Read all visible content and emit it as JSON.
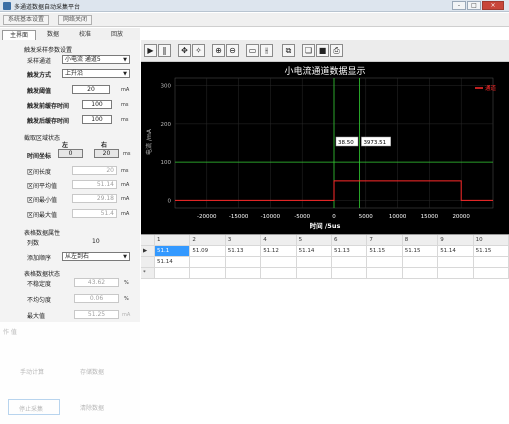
{
  "window": {
    "title": "多通道数据自动采集平台",
    "controls": [
      "-",
      "□",
      "×"
    ]
  },
  "menu": {
    "system_settings": "系统基本设置",
    "network_close": "网络关闭"
  },
  "tabs": [
    "主界面",
    "数据",
    "校准",
    "回放"
  ],
  "params": {
    "group_title": "触发采样参数设置",
    "channel_label": "采样通道",
    "channel_value": "小电流 通道5",
    "trigger_mode_label": "触发方式",
    "trigger_mode_value": "上升沿",
    "threshold_label": "触发阈值",
    "threshold_value": "20",
    "threshold_unit": "mA",
    "pre_time_label": "触发前缓存时间",
    "pre_time_value": "100",
    "pre_time_unit": "ms",
    "post_time_label": "触发后缓存时间",
    "post_time_value": "100",
    "post_time_unit": "ms"
  },
  "cursor": {
    "group_title": "截取区域状态",
    "left_label": "左",
    "right_label": "右",
    "time_coord_label": "时间坐标",
    "left_value": "0",
    "right_value": "20",
    "unit": "ms",
    "length_label": "区间长度",
    "length_value": "20",
    "length_unit": "ms",
    "avg_label": "区间平均值",
    "avg_value": "51.14",
    "avg_unit": "mA",
    "min_label": "区间最小值",
    "min_value": "29.18",
    "min_unit": "mA",
    "max_label": "区间最大值",
    "max_value": "51.4",
    "max_unit": "mA"
  },
  "table_props": {
    "group_title": "表格数据属性",
    "columns_label": "列数",
    "columns_value": "10",
    "order_label": "添加顺序",
    "order_value": "从左到右"
  },
  "table_status": {
    "group_title": "表格数据状态",
    "instability_label": "不稳定度",
    "instability_value": "43.62",
    "instability_unit": "%",
    "balance_label": "不均匀度",
    "balance_value": "0.06",
    "balance_unit": "%",
    "maximum_label": "最大值",
    "maximum_value": "51.25",
    "maximum_unit": "mA"
  },
  "faded_buttons": {
    "value_label": "作 值",
    "manual_label": "手动计算",
    "save_label": "存储数据",
    "stop_label": "停止采集",
    "clear_label": "清除数据"
  },
  "toolbar": {
    "icons": [
      "play-icon",
      "pause-icon",
      "pan-icon",
      "select-icon",
      "zoom-in-icon",
      "zoom-out-icon",
      "zoom-box-icon",
      "cursor-icon",
      "copy-icon",
      "paste-icon",
      "save-icon",
      "print-icon"
    ]
  },
  "chart_data": {
    "type": "line",
    "title": "小电流通道数据显示",
    "xlabel": "时间 /5us",
    "ylabel": "电流 /mA",
    "xlim": [
      -25000,
      25000
    ],
    "ylim": [
      -20,
      320
    ],
    "xticks": [
      "-20000",
      "-15000",
      "-10000",
      "-5000",
      "0",
      "5000",
      "10000",
      "15000",
      "20000"
    ],
    "yticks": [
      "0",
      "100",
      "200",
      "300"
    ],
    "series": [
      {
        "name": "通道",
        "color": "#ff2a2a",
        "x": [
          -25000,
          0,
          0,
          20000,
          20000,
          25000
        ],
        "y": [
          0,
          0,
          51,
          51,
          0,
          0
        ]
      }
    ],
    "cursors": {
      "horizontal_y": 100,
      "vertical_x": [
        0,
        4000
      ],
      "color": "#33cc33"
    },
    "annotations": [
      {
        "text": "38.50",
        "x": 0
      },
      {
        "text": "3973.51",
        "x": 4000
      }
    ],
    "grid": true,
    "background": "#000000"
  },
  "grid": {
    "columns": [
      "1",
      "2",
      "3",
      "4",
      "5",
      "6",
      "7",
      "8",
      "9",
      "10"
    ],
    "rows": [
      [
        "51.1",
        "51.09",
        "51.13",
        "51.12",
        "51.14",
        "51.13",
        "51.15",
        "51.15",
        "51.14",
        "51.15"
      ],
      [
        "51.14",
        "",
        "",
        "",
        "",
        "",
        "",
        "",
        "",
        ""
      ],
      [
        "",
        "",
        "",
        "",
        "",
        "",
        "",
        "",
        "",
        ""
      ]
    ],
    "row_markers": [
      "▶",
      "",
      "*"
    ]
  }
}
